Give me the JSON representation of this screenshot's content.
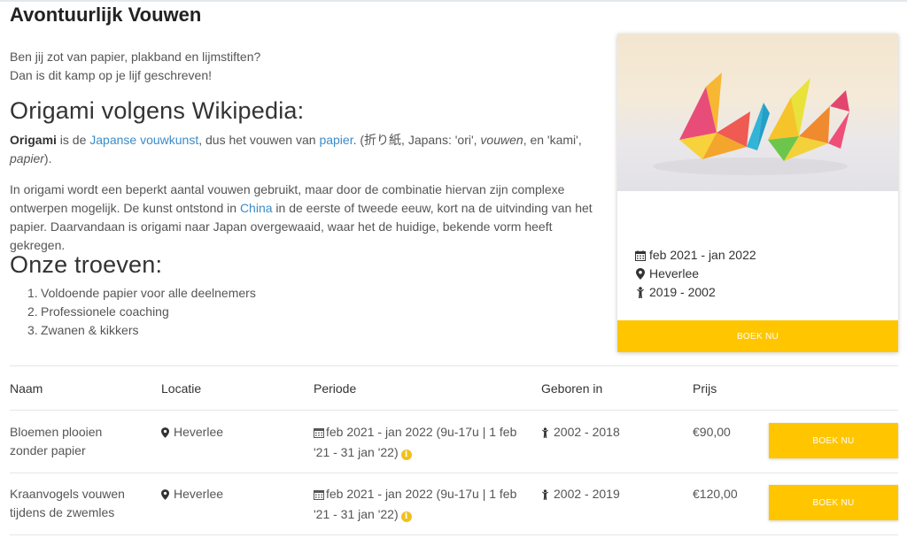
{
  "page": {
    "title": "Avontuurlijk Vouwen",
    "intro_line1": "Ben jij zot van papier, plakband en lijmstiften?",
    "intro_line2": "Dan is dit kamp op je lijf geschreven!"
  },
  "wiki": {
    "heading": "Origami volgens Wikipedia:",
    "p1_bold": "Origami",
    "p1_t1": " is de ",
    "p1_link1": "Japanse vouwkunst",
    "p1_t2": ", dus het vouwen van ",
    "p1_link2": "papier",
    "p1_t3": ". (折り紙, Japans: 'ori', ",
    "p1_i1": "vouwen",
    "p1_t4": ", en 'kami', ",
    "p1_i2": "papier",
    "p1_t5": ").",
    "p2_t1": "In origami wordt een beperkt aantal vouwen gebruikt, maar door de combinatie hiervan zijn complexe ontwerpen mogelijk. De kunst ontstond in ",
    "p2_link": "China",
    "p2_t2": " in de eerste of tweede eeuw, kort na de uitvinding van het papier. Daarvandaan is origami naar Japan overgewaaid, waar het de huidige, bekende vorm heeft gekregen."
  },
  "troeven": {
    "heading": "Onze troeven:",
    "items": [
      {
        "num": "1.",
        "text": "Voldoende papier voor alle deelnemers"
      },
      {
        "num": "2.",
        "text": "Professionele coaching"
      },
      {
        "num": "3.",
        "text": "Zwanen & kikkers"
      }
    ]
  },
  "card": {
    "period": "feb 2021 - jan 2022",
    "location": "Heverlee",
    "birth_years": "2019 - 2002",
    "button": "BOEK NU"
  },
  "table": {
    "headers": [
      "Naam",
      "Locatie",
      "Periode",
      "Geboren in",
      "Prijs"
    ],
    "rows": [
      {
        "name_l1": "Bloemen plooien",
        "name_l2": "zonder papier",
        "location": "Heverlee",
        "period_l1": "feb 2021 - jan 2022 (9u-17u | 1 feb",
        "period_l2": "'21 - 31 jan '22)",
        "born": "2002 - 2018",
        "price": "€90,00",
        "button": "BOEK NU"
      },
      {
        "name_l1": "Kraanvogels vouwen",
        "name_l2": "tijdens de zwemles",
        "location": "Heverlee",
        "period_l1": "feb 2021 - jan 2022 (9u-17u | 1 feb",
        "period_l2": "'21 - 31 jan '22)",
        "born": "2002 - 2019",
        "price": "€120,00",
        "button": "BOEK NU"
      }
    ]
  },
  "icons": {
    "calendar": "calendar-icon",
    "location": "map-marker-icon",
    "child": "child-icon",
    "info": "info-circle-icon"
  },
  "colors": {
    "accent": "#ffc600",
    "link": "#3b8bc9",
    "info": "#f2c01e"
  }
}
